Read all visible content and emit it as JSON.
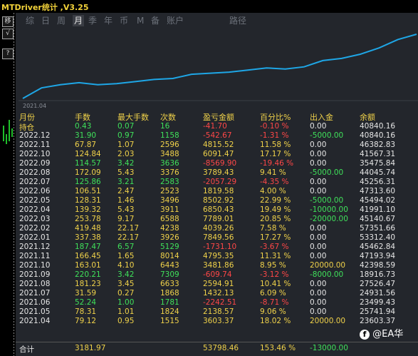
{
  "window": {
    "title": "MTDriver统计 ,V3.25"
  },
  "side_buttons": [
    "移",
    "√",
    "?"
  ],
  "tabs": [
    "综",
    "日",
    "周",
    "月",
    "季",
    "年",
    "币",
    "M",
    "备",
    "账户",
    "路径"
  ],
  "active_tab": "月",
  "chart": {
    "x_label": "2021.04",
    "line_color": "#1ea6e6",
    "values": [
      0,
      1,
      1.3,
      1.5,
      1.3,
      1.4,
      1.6,
      1.8,
      1.9,
      2.3,
      2.4,
      2.5,
      2.7,
      2.9,
      2.8,
      3.0,
      3.6,
      3.8,
      4.2,
      4.8,
      5.6,
      6.1
    ]
  },
  "table": {
    "headers": [
      "月份",
      "手数",
      "最大手数",
      "次数",
      "盈亏金额",
      "百分比%",
      "出入金",
      "余额"
    ],
    "rows": [
      [
        "持仓",
        "0.43",
        "0.07",
        "16",
        "-41.70",
        "-0.10 %",
        "0.00",
        "40840.16"
      ],
      [
        "2022.12",
        "31.90",
        "0.97",
        "1158",
        "-542.67",
        "-1.31 %",
        "-5000.00",
        "40840.16"
      ],
      [
        "2022.11",
        "67.87",
        "1.07",
        "2596",
        "4815.52",
        "11.58 %",
        "0.00",
        "46382.83"
      ],
      [
        "2022.10",
        "124.84",
        "2.03",
        "3488",
        "6091.47",
        "17.17 %",
        "0.00",
        "41567.31"
      ],
      [
        "2022.09",
        "114.57",
        "3.42",
        "3636",
        "-8569.90",
        "-19.46 %",
        "0.00",
        "35475.84"
      ],
      [
        "2022.08",
        "172.09",
        "5.43",
        "3376",
        "3789.43",
        "9.41 %",
        "-5000.00",
        "44045.74"
      ],
      [
        "2022.07",
        "125.86",
        "3.21",
        "2583",
        "-2057.29",
        "-4.35 %",
        "0.00",
        "45256.31"
      ],
      [
        "2022.06",
        "106.51",
        "2.47",
        "2523",
        "1819.58",
        "4.00 %",
        "0.00",
        "47313.60"
      ],
      [
        "2022.05",
        "128.31",
        "1.46",
        "3496",
        "8502.92",
        "22.99 %",
        "-5000.00",
        "45494.02"
      ],
      [
        "2022.04",
        "139.32",
        "5.43",
        "3911",
        "6850.43",
        "19.49 %",
        "-10000.00",
        "41991.10"
      ],
      [
        "2022.03",
        "253.78",
        "9.17",
        "6588",
        "7789.01",
        "20.85 %",
        "-20000.00",
        "45140.67"
      ],
      [
        "2022.02",
        "419.48",
        "22.17",
        "4238",
        "4039.26",
        "7.58 %",
        "0.00",
        "57351.66"
      ],
      [
        "2022.01",
        "337.38",
        "22.17",
        "3926",
        "7849.56",
        "17.27 %",
        "0.00",
        "53312.40"
      ],
      [
        "2021.12",
        "187.47",
        "6.57",
        "5129",
        "-1731.10",
        "-3.67 %",
        "0.00",
        "45462.84"
      ],
      [
        "2021.11",
        "166.45",
        "1.65",
        "8014",
        "4795.35",
        "11.31 %",
        "0.00",
        "47193.94"
      ],
      [
        "2021.10",
        "163.01",
        "4.10",
        "6443",
        "3481.86",
        "8.95 %",
        "20000.00",
        "42398.59"
      ],
      [
        "2021.09",
        "220.21",
        "3.42",
        "7309",
        "-609.74",
        "-3.12 %",
        "-8000.00",
        "18916.73"
      ],
      [
        "2021.08",
        "181.23",
        "3.45",
        "6633",
        "2594.91",
        "10.41 %",
        "0.00",
        "27526.47"
      ],
      [
        "2021.07",
        "31.59",
        "0.27",
        "1868",
        "1432.13",
        "6.09 %",
        "0.00",
        "24931.56"
      ],
      [
        "2021.06",
        "52.24",
        "1.00",
        "1781",
        "-2242.51",
        "-8.71 %",
        "0.00",
        "23499.43"
      ],
      [
        "2021.05",
        "78.31",
        "1.01",
        "1824",
        "2138.57",
        "9.06 %",
        "0.00",
        "25741.94"
      ],
      [
        "2021.04",
        "79.12",
        "0.95",
        "1515",
        "3603.37",
        "18.02 %",
        "20000.00",
        "23603.37"
      ]
    ],
    "total": [
      "合计",
      "3181.97",
      "",
      "",
      "53798.46",
      "153.46 %",
      "-13000.00",
      ""
    ]
  },
  "watermark": {
    "logo": "f",
    "text": "@EA华"
  },
  "colors": {
    "positive": "#3fe05a",
    "negative": "#ff4747",
    "header": "#f0d24a",
    "text": "#e6e6e6"
  }
}
